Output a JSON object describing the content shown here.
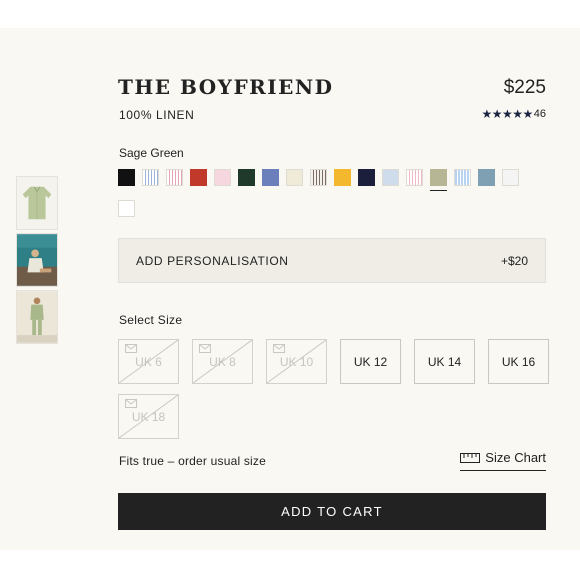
{
  "product": {
    "title": "THE BOYFRIEND",
    "price": "$225",
    "material": "100% LINEN",
    "rating": {
      "stars": "★★★★★",
      "count": "46",
      "value": 5
    }
  },
  "colors": {
    "selected_label": "Sage Green",
    "swatches": [
      {
        "name": "black",
        "hex": "#111111"
      },
      {
        "name": "blue-stripe",
        "hex": "#9db2d8"
      },
      {
        "name": "pink-stripe",
        "hex": "#e7a4b4"
      },
      {
        "name": "red",
        "hex": "#c0392b"
      },
      {
        "name": "pale-pink",
        "hex": "#f7d7df"
      },
      {
        "name": "dark-green",
        "hex": "#1f3a2b"
      },
      {
        "name": "periwinkle",
        "hex": "#6b7fbd"
      },
      {
        "name": "cream",
        "hex": "#f0ead8"
      },
      {
        "name": "brown-stripe",
        "hex": "#7a6a6a"
      },
      {
        "name": "yellow",
        "hex": "#f4b82e"
      },
      {
        "name": "navy",
        "hex": "#1b1f3b"
      },
      {
        "name": "light-blue",
        "hex": "#cfdcec"
      },
      {
        "name": "pink-stripe-2",
        "hex": "#f0b9c6"
      },
      {
        "name": "sage-green",
        "hex": "#b7b694",
        "selected": true
      },
      {
        "name": "sky-stripe",
        "hex": "#b7d3f1"
      },
      {
        "name": "steel-blue",
        "hex": "#7f9fb3"
      },
      {
        "name": "off-white",
        "hex": "#f4f4f4"
      },
      {
        "name": "white",
        "hex": "#ffffff"
      }
    ]
  },
  "personalisation": {
    "label": "ADD PERSONALISATION",
    "price": "+$20"
  },
  "sizes": {
    "label": "Select Size",
    "options": [
      {
        "label": "UK 6",
        "available": false
      },
      {
        "label": "UK 8",
        "available": false
      },
      {
        "label": "UK 10",
        "available": false
      },
      {
        "label": "UK 12",
        "available": true
      },
      {
        "label": "UK 14",
        "available": true
      },
      {
        "label": "UK 16",
        "available": true
      },
      {
        "label": "UK 18",
        "available": false
      }
    ]
  },
  "fit": {
    "text": "Fits true – order usual size",
    "size_chart_label": "Size Chart"
  },
  "cart": {
    "button_label": "ADD TO CART"
  },
  "theme": {
    "accent": "#222222",
    "background": "#f9f8f3",
    "star_color": "#1c2541"
  }
}
